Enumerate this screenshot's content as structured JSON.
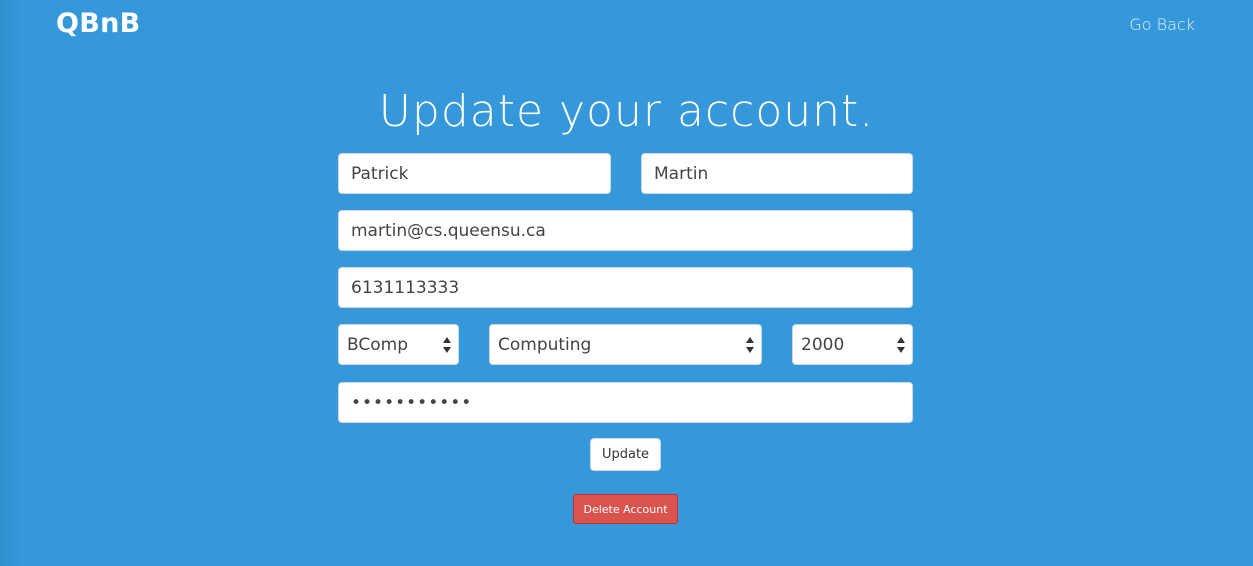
{
  "header": {
    "brand": "QBnB",
    "go_back": "Go Back"
  },
  "form": {
    "title": "Update your account.",
    "first_name": "Patrick",
    "last_name": "Martin",
    "email": "martin@cs.queensu.ca",
    "phone": "6131113333",
    "degree": "BComp",
    "faculty": "Computing",
    "year": "2000",
    "password": "•••••••••••",
    "update_label": "Update",
    "delete_label": "Delete Account"
  },
  "colors": {
    "background": "#3498db",
    "delete_button": "#d9534f"
  }
}
